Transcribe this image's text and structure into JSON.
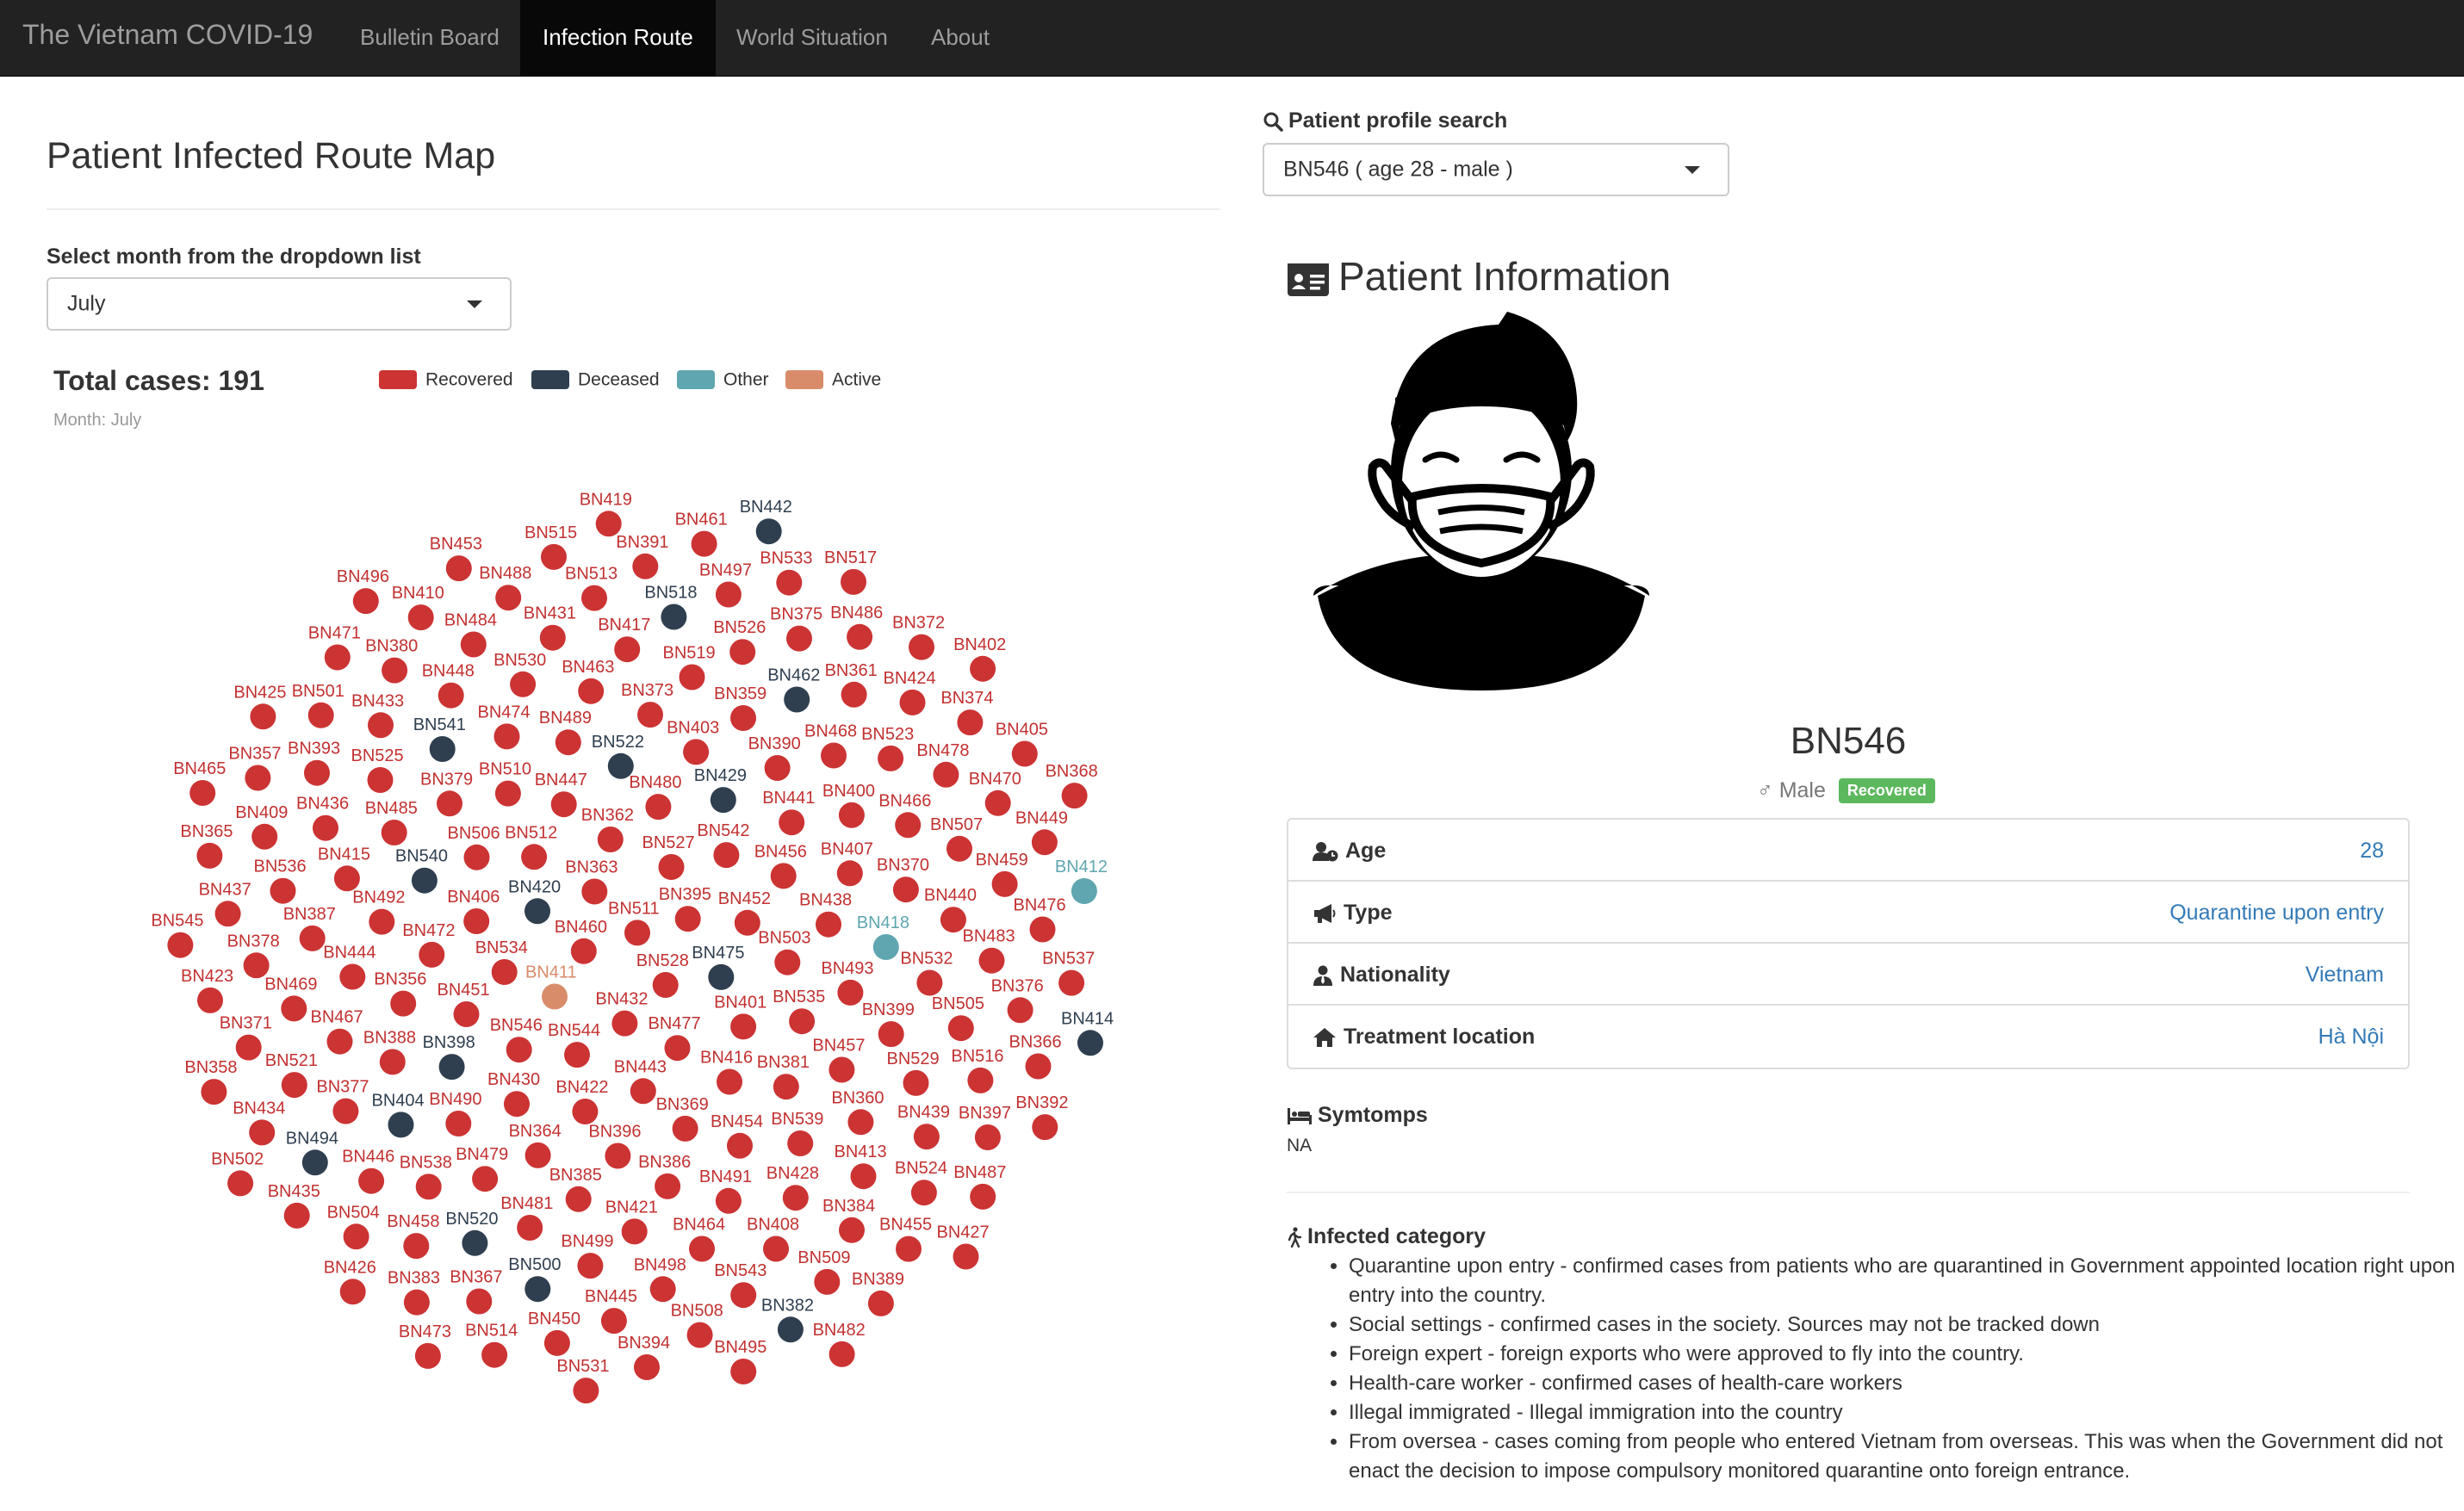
{
  "nav": {
    "brand": "The Vietnam COVID-19",
    "items": [
      "Bulletin Board",
      "Infection Route",
      "World Situation",
      "About"
    ],
    "active": "Infection Route"
  },
  "left": {
    "title": "Patient Infected Route Map",
    "month_label": "Select month from the dropdown list",
    "month_value": "July",
    "total_cases": "Total cases: 191",
    "month_sub": "Month: July",
    "legend": [
      {
        "label": "Recovered",
        "color": "#cc3333"
      },
      {
        "label": "Deceased",
        "color": "#2f3f50"
      },
      {
        "label": "Other",
        "color": "#5fa6b0"
      },
      {
        "label": "Active",
        "color": "#d98c6a"
      }
    ]
  },
  "graph": {
    "status_colors": {
      "R": "#cc3333",
      "D": "#2f3f50",
      "O": "#5fa6b0",
      "A": "#d98c6a"
    },
    "label_colors": {
      "R": "#c23131",
      "D": "#2f3f50",
      "O": "#5fa6b0",
      "A": "#d98c6a"
    },
    "nodes": [
      {
        "id": "BN511",
        "s": "R"
      },
      {
        "id": "BN528",
        "s": "R"
      },
      {
        "id": "BN460",
        "s": "R"
      },
      {
        "id": "BN395",
        "s": "R"
      },
      {
        "id": "BN432",
        "s": "R"
      },
      {
        "id": "BN363",
        "s": "R"
      },
      {
        "id": "BN475",
        "s": "D"
      },
      {
        "id": "BN411",
        "s": "A"
      },
      {
        "id": "BN527",
        "s": "R"
      },
      {
        "id": "BN477",
        "s": "R"
      },
      {
        "id": "BN420",
        "s": "D"
      },
      {
        "id": "BN452",
        "s": "R"
      },
      {
        "id": "BN544",
        "s": "R"
      },
      {
        "id": "BN362",
        "s": "R"
      },
      {
        "id": "BN401",
        "s": "R"
      },
      {
        "id": "BN534",
        "s": "R"
      },
      {
        "id": "BN542",
        "s": "R"
      },
      {
        "id": "BN443",
        "s": "R"
      },
      {
        "id": "BN512",
        "s": "R"
      },
      {
        "id": "BN503",
        "s": "R"
      },
      {
        "id": "BN546",
        "s": "R"
      },
      {
        "id": "BN480",
        "s": "R"
      },
      {
        "id": "BN416",
        "s": "R"
      },
      {
        "id": "BN406",
        "s": "R"
      },
      {
        "id": "BN456",
        "s": "R"
      },
      {
        "id": "BN422",
        "s": "R"
      },
      {
        "id": "BN447",
        "s": "R"
      },
      {
        "id": "BN535",
        "s": "R"
      },
      {
        "id": "BN451",
        "s": "R"
      },
      {
        "id": "BN429",
        "s": "D"
      },
      {
        "id": "BN369",
        "s": "R"
      },
      {
        "id": "BN506",
        "s": "R"
      },
      {
        "id": "BN438",
        "s": "R"
      },
      {
        "id": "BN430",
        "s": "R"
      },
      {
        "id": "BN522",
        "s": "D"
      },
      {
        "id": "BN381",
        "s": "R"
      },
      {
        "id": "BN472",
        "s": "R"
      },
      {
        "id": "BN441",
        "s": "R"
      },
      {
        "id": "BN396",
        "s": "R"
      },
      {
        "id": "BN510",
        "s": "R"
      },
      {
        "id": "BN493",
        "s": "R"
      },
      {
        "id": "BN398",
        "s": "D"
      },
      {
        "id": "BN403",
        "s": "R"
      },
      {
        "id": "BN454",
        "s": "R"
      },
      {
        "id": "BN540",
        "s": "D"
      },
      {
        "id": "BN407",
        "s": "R"
      },
      {
        "id": "BN364",
        "s": "R"
      },
      {
        "id": "BN489",
        "s": "R"
      },
      {
        "id": "BN457",
        "s": "R"
      },
      {
        "id": "BN356",
        "s": "R"
      },
      {
        "id": "BN390",
        "s": "R"
      },
      {
        "id": "BN386",
        "s": "R"
      },
      {
        "id": "BN379",
        "s": "R"
      },
      {
        "id": "BN418",
        "s": "O"
      },
      {
        "id": "BN490",
        "s": "R"
      },
      {
        "id": "BN373",
        "s": "R"
      },
      {
        "id": "BN539",
        "s": "R"
      },
      {
        "id": "BN492",
        "s": "R"
      },
      {
        "id": "BN400",
        "s": "R"
      },
      {
        "id": "BN385",
        "s": "R"
      },
      {
        "id": "BN474",
        "s": "R"
      },
      {
        "id": "BN399",
        "s": "R"
      },
      {
        "id": "BN388",
        "s": "R"
      },
      {
        "id": "BN359",
        "s": "R"
      },
      {
        "id": "BN491",
        "s": "R"
      },
      {
        "id": "BN485",
        "s": "R"
      },
      {
        "id": "BN370",
        "s": "R"
      },
      {
        "id": "BN479",
        "s": "R"
      },
      {
        "id": "BN463",
        "s": "R"
      },
      {
        "id": "BN360",
        "s": "R"
      },
      {
        "id": "BN444",
        "s": "R"
      },
      {
        "id": "BN468",
        "s": "R"
      },
      {
        "id": "BN421",
        "s": "R"
      },
      {
        "id": "BN541",
        "s": "D"
      },
      {
        "id": "BN532",
        "s": "R"
      },
      {
        "id": "BN404",
        "s": "D"
      },
      {
        "id": "BN519",
        "s": "R"
      },
      {
        "id": "BN428",
        "s": "R"
      },
      {
        "id": "BN415",
        "s": "R"
      },
      {
        "id": "BN466",
        "s": "R"
      },
      {
        "id": "BN481",
        "s": "R"
      },
      {
        "id": "BN530",
        "s": "R"
      },
      {
        "id": "BN529",
        "s": "R"
      },
      {
        "id": "BN467",
        "s": "R"
      },
      {
        "id": "BN462",
        "s": "D"
      },
      {
        "id": "BN464",
        "s": "R"
      },
      {
        "id": "BN525",
        "s": "R"
      },
      {
        "id": "BN440",
        "s": "R"
      },
      {
        "id": "BN538",
        "s": "R"
      },
      {
        "id": "BN417",
        "s": "R"
      },
      {
        "id": "BN413",
        "s": "R"
      },
      {
        "id": "BN387",
        "s": "R"
      },
      {
        "id": "BN523",
        "s": "R"
      },
      {
        "id": "BN499",
        "s": "R"
      },
      {
        "id": "BN448",
        "s": "R"
      },
      {
        "id": "BN505",
        "s": "R"
      },
      {
        "id": "BN377",
        "s": "R"
      },
      {
        "id": "BN526",
        "s": "R"
      },
      {
        "id": "BN408",
        "s": "R"
      },
      {
        "id": "BN436",
        "s": "R"
      },
      {
        "id": "BN507",
        "s": "R"
      },
      {
        "id": "BN520",
        "s": "D"
      },
      {
        "id": "BN431",
        "s": "R"
      },
      {
        "id": "BN439",
        "s": "R"
      },
      {
        "id": "BN469",
        "s": "R"
      },
      {
        "id": "BN361",
        "s": "R"
      },
      {
        "id": "BN498",
        "s": "R"
      },
      {
        "id": "BN433",
        "s": "R"
      },
      {
        "id": "BN483",
        "s": "R"
      },
      {
        "id": "BN446",
        "s": "R"
      },
      {
        "id": "BN518",
        "s": "D"
      },
      {
        "id": "BN384",
        "s": "R"
      },
      {
        "id": "BN536",
        "s": "R"
      },
      {
        "id": "BN478",
        "s": "R"
      },
      {
        "id": "BN500",
        "s": "D"
      },
      {
        "id": "BN484",
        "s": "R"
      },
      {
        "id": "BN516",
        "s": "R"
      },
      {
        "id": "BN521",
        "s": "R"
      },
      {
        "id": "BN375",
        "s": "R"
      },
      {
        "id": "BN543",
        "s": "R"
      },
      {
        "id": "BN393",
        "s": "R"
      },
      {
        "id": "BN459",
        "s": "R"
      },
      {
        "id": "BN458",
        "s": "R"
      },
      {
        "id": "BN513",
        "s": "R"
      },
      {
        "id": "BN524",
        "s": "R"
      },
      {
        "id": "BN378",
        "s": "R"
      },
      {
        "id": "BN424",
        "s": "R"
      },
      {
        "id": "BN445",
        "s": "R"
      },
      {
        "id": "BN380",
        "s": "R"
      },
      {
        "id": "BN376",
        "s": "R"
      },
      {
        "id": "BN494",
        "s": "D"
      },
      {
        "id": "BN497",
        "s": "R"
      },
      {
        "id": "BN509",
        "s": "R"
      },
      {
        "id": "BN409",
        "s": "R"
      },
      {
        "id": "BN470",
        "s": "R"
      },
      {
        "id": "BN367",
        "s": "R"
      },
      {
        "id": "BN488",
        "s": "R"
      },
      {
        "id": "BN397",
        "s": "R"
      },
      {
        "id": "BN371",
        "s": "R"
      },
      {
        "id": "BN486",
        "s": "R"
      },
      {
        "id": "BN508",
        "s": "R"
      },
      {
        "id": "BN501",
        "s": "R"
      },
      {
        "id": "BN476",
        "s": "R"
      },
      {
        "id": "BN504",
        "s": "R"
      },
      {
        "id": "BN391",
        "s": "R"
      },
      {
        "id": "BN455",
        "s": "R"
      },
      {
        "id": "BN437",
        "s": "R"
      },
      {
        "id": "BN374",
        "s": "R"
      },
      {
        "id": "BN450",
        "s": "R"
      },
      {
        "id": "BN410",
        "s": "R"
      },
      {
        "id": "BN366",
        "s": "R"
      },
      {
        "id": "BN434",
        "s": "R"
      },
      {
        "id": "BN533",
        "s": "R"
      },
      {
        "id": "BN382",
        "s": "D"
      },
      {
        "id": "BN357",
        "s": "R"
      },
      {
        "id": "BN449",
        "s": "R"
      },
      {
        "id": "BN383",
        "s": "R"
      },
      {
        "id": "BN515",
        "s": "R"
      },
      {
        "id": "BN487",
        "s": "R"
      },
      {
        "id": "BN423",
        "s": "R"
      },
      {
        "id": "BN372",
        "s": "R"
      },
      {
        "id": "BN394",
        "s": "R"
      },
      {
        "id": "BN471",
        "s": "R"
      },
      {
        "id": "BN537",
        "s": "R"
      },
      {
        "id": "BN435",
        "s": "R"
      },
      {
        "id": "BN461",
        "s": "R"
      },
      {
        "id": "BN389",
        "s": "R"
      },
      {
        "id": "BN365",
        "s": "R"
      },
      {
        "id": "BN405",
        "s": "R"
      },
      {
        "id": "BN514",
        "s": "R"
      },
      {
        "id": "BN453",
        "s": "R"
      },
      {
        "id": "BN392",
        "s": "R"
      },
      {
        "id": "BN358",
        "s": "R"
      },
      {
        "id": "BN517",
        "s": "R"
      },
      {
        "id": "BN495",
        "s": "R"
      },
      {
        "id": "BN425",
        "s": "R"
      },
      {
        "id": "BN412",
        "s": "O"
      },
      {
        "id": "BN426",
        "s": "R"
      },
      {
        "id": "BN419",
        "s": "R"
      },
      {
        "id": "BN427",
        "s": "R"
      },
      {
        "id": "BN545",
        "s": "R"
      },
      {
        "id": "BN402",
        "s": "R"
      },
      {
        "id": "BN531",
        "s": "R"
      },
      {
        "id": "BN496",
        "s": "R"
      },
      {
        "id": "BN414",
        "s": "D"
      },
      {
        "id": "BN502",
        "s": "R"
      },
      {
        "id": "BN442",
        "s": "D"
      },
      {
        "id": "BN482",
        "s": "R"
      },
      {
        "id": "BN465",
        "s": "R"
      },
      {
        "id": "BN368",
        "s": "R"
      },
      {
        "id": "BN473",
        "s": "R"
      }
    ]
  },
  "search": {
    "label": "Patient profile search",
    "value": "BN546 ( age 28 - male )"
  },
  "patient": {
    "section_title": "Patient Information",
    "id": "BN546",
    "gender_symbol": "♂",
    "gender": "Male",
    "status": "Recovered",
    "rows": [
      {
        "label": "Age",
        "value": "28"
      },
      {
        "label": "Type",
        "value": "Quarantine upon entry"
      },
      {
        "label": "Nationality",
        "value": "Vietnam"
      },
      {
        "label": "Treatment location",
        "value": "Hà Nội"
      }
    ],
    "symptoms_label": "Symtomps",
    "symptoms_value": "NA",
    "category_label": "Infected category",
    "categories": [
      "Quarantine upon entry - confirmed cases from patients who are quarantined in Government appointed location right upon entry into the country.",
      "Social settings - confirmed cases in the society. Sources may not be tracked down",
      "Foreign expert - foreign exports who were approved to fly into the country.",
      "Health-care worker - confirmed cases of health-care workers",
      "Illegal immigrated - Illegal immigration into the country",
      "From oversea - cases coming from people who entered Vietnam from overseas. This was when the Government did not enact the decision to impose compulsory monitored quarantine onto foreign entrance."
    ]
  }
}
